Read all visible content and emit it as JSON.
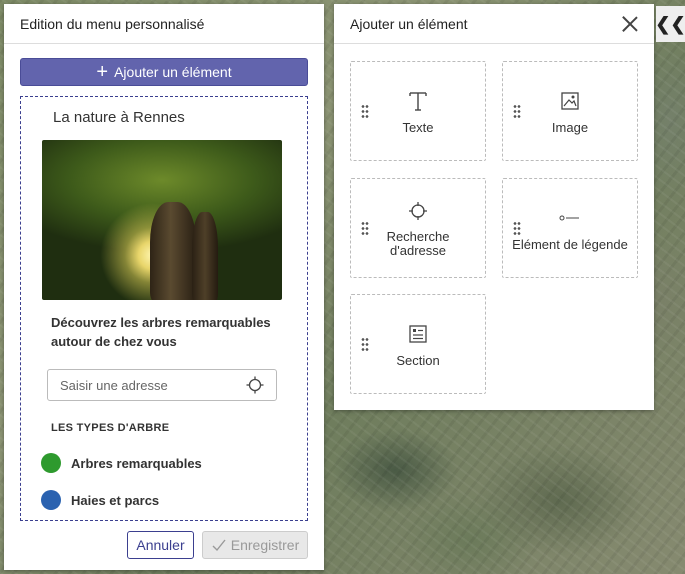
{
  "left_panel": {
    "title": "Edition du menu personnalisé",
    "add_button": "Ajouter un élément",
    "menu_title": "La nature à Rennes",
    "description": "Découvrez les arbres remarquables autour de chez vous",
    "address_placeholder": "Saisir une adresse",
    "legend_title": "LES TYPES D'ARBRE",
    "legend_items": [
      {
        "label": "Arbres remarquables",
        "color": "#2e9a2e"
      },
      {
        "label": "Haies et parcs",
        "color": "#2a62b0"
      }
    ],
    "cancel_button": "Annuler",
    "save_button": "Enregistrer"
  },
  "right_panel": {
    "title": "Ajouter un élément",
    "tiles": [
      {
        "label": "Texte",
        "icon": "text-icon"
      },
      {
        "label": "Image",
        "icon": "image-icon"
      },
      {
        "label": "Recherche d'adresse",
        "icon": "crosshair-icon"
      },
      {
        "label": "Elément de légende",
        "icon": "legend-icon"
      },
      {
        "label": "Section",
        "icon": "section-icon"
      }
    ]
  },
  "colors": {
    "accent": "#6264ad",
    "accent_dark": "#3b3f8f"
  }
}
